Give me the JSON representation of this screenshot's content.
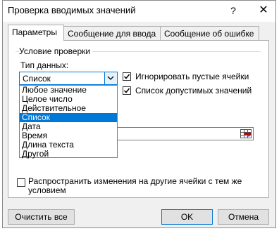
{
  "dialog": {
    "title": "Проверка вводимых значений",
    "help_label": "?",
    "close_label": "✕"
  },
  "tabs": [
    {
      "label": "Параметры",
      "active": true
    },
    {
      "label": "Сообщение для ввода",
      "active": false
    },
    {
      "label": "Сообщение об ошибке",
      "active": false
    }
  ],
  "validation": {
    "group_label": "Условие проверки",
    "data_type_label": "Тип данных:",
    "data_type_value": "Список",
    "options": [
      "Любое значение",
      "Целое число",
      "Действительное",
      "Список",
      "Дата",
      "Время",
      "Длина текста",
      "Другой"
    ],
    "selected_option": "Список",
    "ignore_blank_label": "Игнорировать пустые ячейки",
    "ignore_blank_checked": true,
    "dropdown_label": "Список допустимых значений",
    "dropdown_checked": true,
    "source_value": ""
  },
  "apply_all": {
    "label": "Распространить изменения на другие ячейки с тем же условием",
    "checked": false
  },
  "buttons": {
    "clear_all": "Очистить все",
    "ok": "OK",
    "cancel": "Отмена"
  },
  "colors": {
    "accent": "#0078d7",
    "dialog_bg": "#f0f0f0",
    "panel_bg": "#ffffff"
  }
}
